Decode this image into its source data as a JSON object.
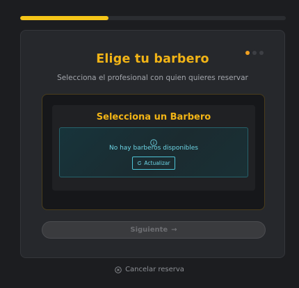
{
  "progress": {
    "fraction": 0.333
  },
  "steps": {
    "total": 3,
    "current": 1
  },
  "header": {
    "title": "Elige tu barbero",
    "subtitle": "Selecciona el profesional con quien quieres reservar"
  },
  "selector": {
    "title": "Selecciona un Barbero",
    "empty_message": "No hay barberos disponibles",
    "refresh_label": "Actualizar"
  },
  "actions": {
    "next_label": "Siguiente",
    "next_arrow": "→",
    "cancel_label": "Cancelar reserva"
  },
  "colors": {
    "accent": "#f2b416",
    "info": "#6ed6e6",
    "background": "#1c1d20"
  },
  "icons": {
    "info": "info-circle-icon",
    "refresh": "refresh-icon",
    "arrow": "arrow-right-icon",
    "cancel": "x-circle-icon"
  }
}
